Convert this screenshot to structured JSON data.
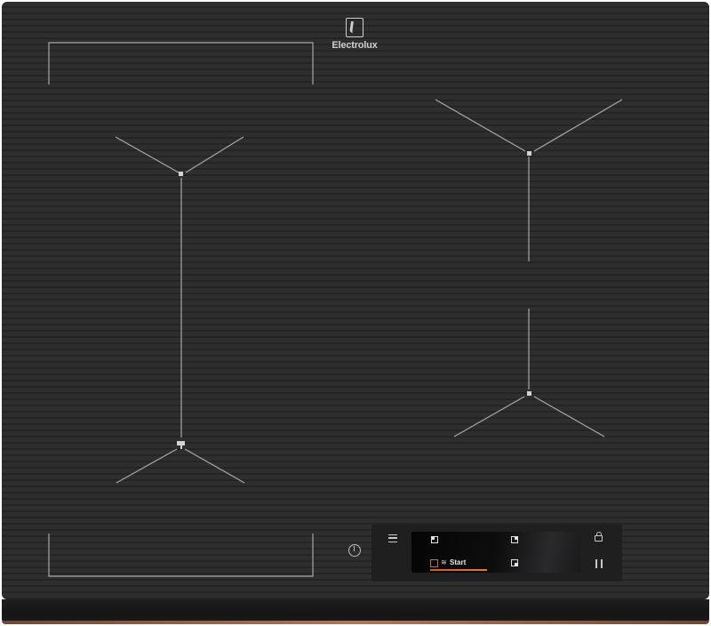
{
  "brand": {
    "name": "Electrolux",
    "logo_icon": "electrolux-logo-icon"
  },
  "control_panel": {
    "power_icon": "power-icon",
    "menu_icon": "menu-icon",
    "lock_icon": "lock-icon",
    "pause_icon": "pause-icon",
    "display": {
      "start_label": "Start",
      "zone_icons": [
        "zone-top-left-icon",
        "zone-top-right-icon",
        "zone-bottom-right-icon",
        "zone-bottom-left-icon"
      ],
      "accent_color": "#d65a2a"
    }
  },
  "colors": {
    "glass": "#2e2e2f",
    "marking_lines": "#a8a8a8",
    "trim": "#a9785e"
  }
}
